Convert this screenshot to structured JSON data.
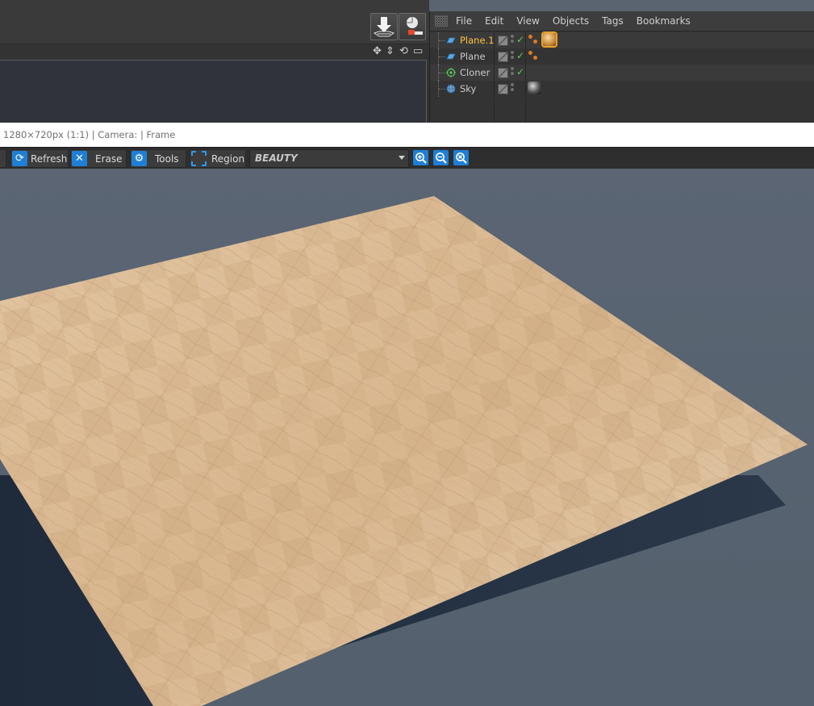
{
  "object_manager": {
    "menu": [
      "File",
      "Edit",
      "View",
      "Objects",
      "Tags",
      "Bookmarks"
    ],
    "objects": [
      {
        "name": "Plane.1",
        "icon": "plane-icon",
        "selected": true
      },
      {
        "name": "Plane",
        "icon": "plane-icon",
        "selected": false
      },
      {
        "name": "Cloner",
        "icon": "cloner-icon",
        "selected": false
      },
      {
        "name": "Sky",
        "icon": "sky-icon",
        "selected": false
      }
    ]
  },
  "status": {
    "text": "1280×720px (1:1) | Camera:  | Frame"
  },
  "render_toolbar": {
    "refresh_label": "Refresh",
    "erase_label": "Erase",
    "tools_label": "Tools",
    "region_label": "Region",
    "render_pass": "BEAUTY"
  },
  "colors": {
    "accent": "#1f7fd6",
    "selected_text": "#ffc23d",
    "background": "#586270",
    "wood": "#d8b68e"
  }
}
